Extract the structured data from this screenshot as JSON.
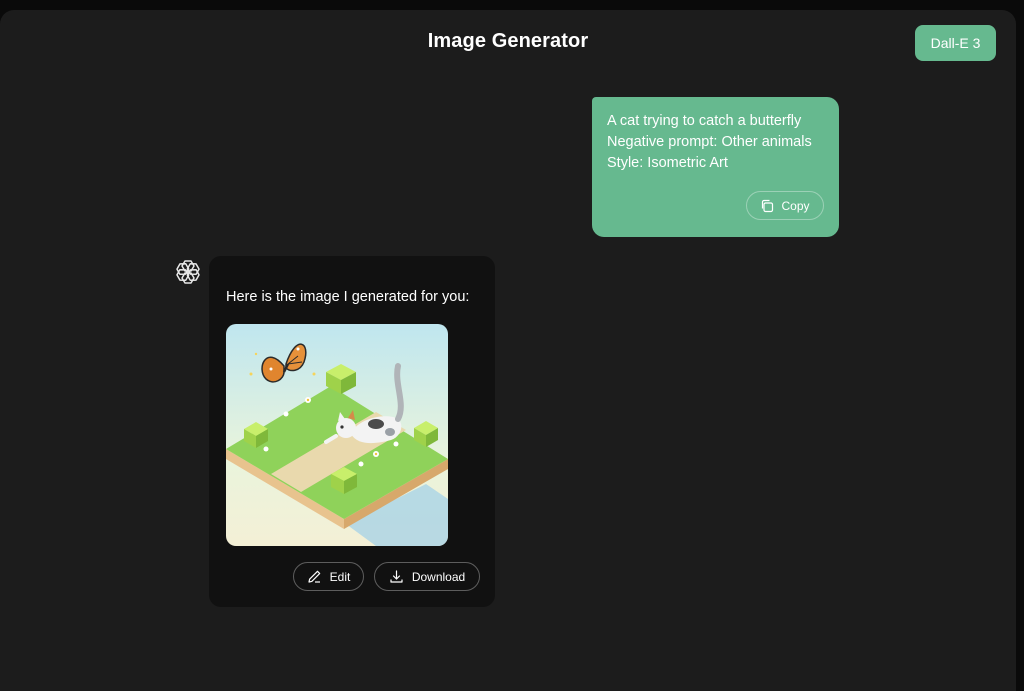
{
  "header": {
    "title": "Image Generator",
    "model_button": "Dall-E 3"
  },
  "user_message": {
    "lines": [
      "A cat trying to catch a butterfly",
      "Negative prompt: Other animals",
      "Style: Isometric Art"
    ],
    "copy_label": "Copy"
  },
  "assistant_message": {
    "text": "Here is the image I generated for you:",
    "edit_label": "Edit",
    "download_label": "Download"
  },
  "colors": {
    "accent": "#66b98f",
    "background": "#1c1c1c",
    "assistant_bubble": "#111111"
  },
  "icons": {
    "assistant_avatar": "openai-logo-icon",
    "copy": "copy-icon",
    "edit": "pencil-icon",
    "download": "download-icon"
  }
}
